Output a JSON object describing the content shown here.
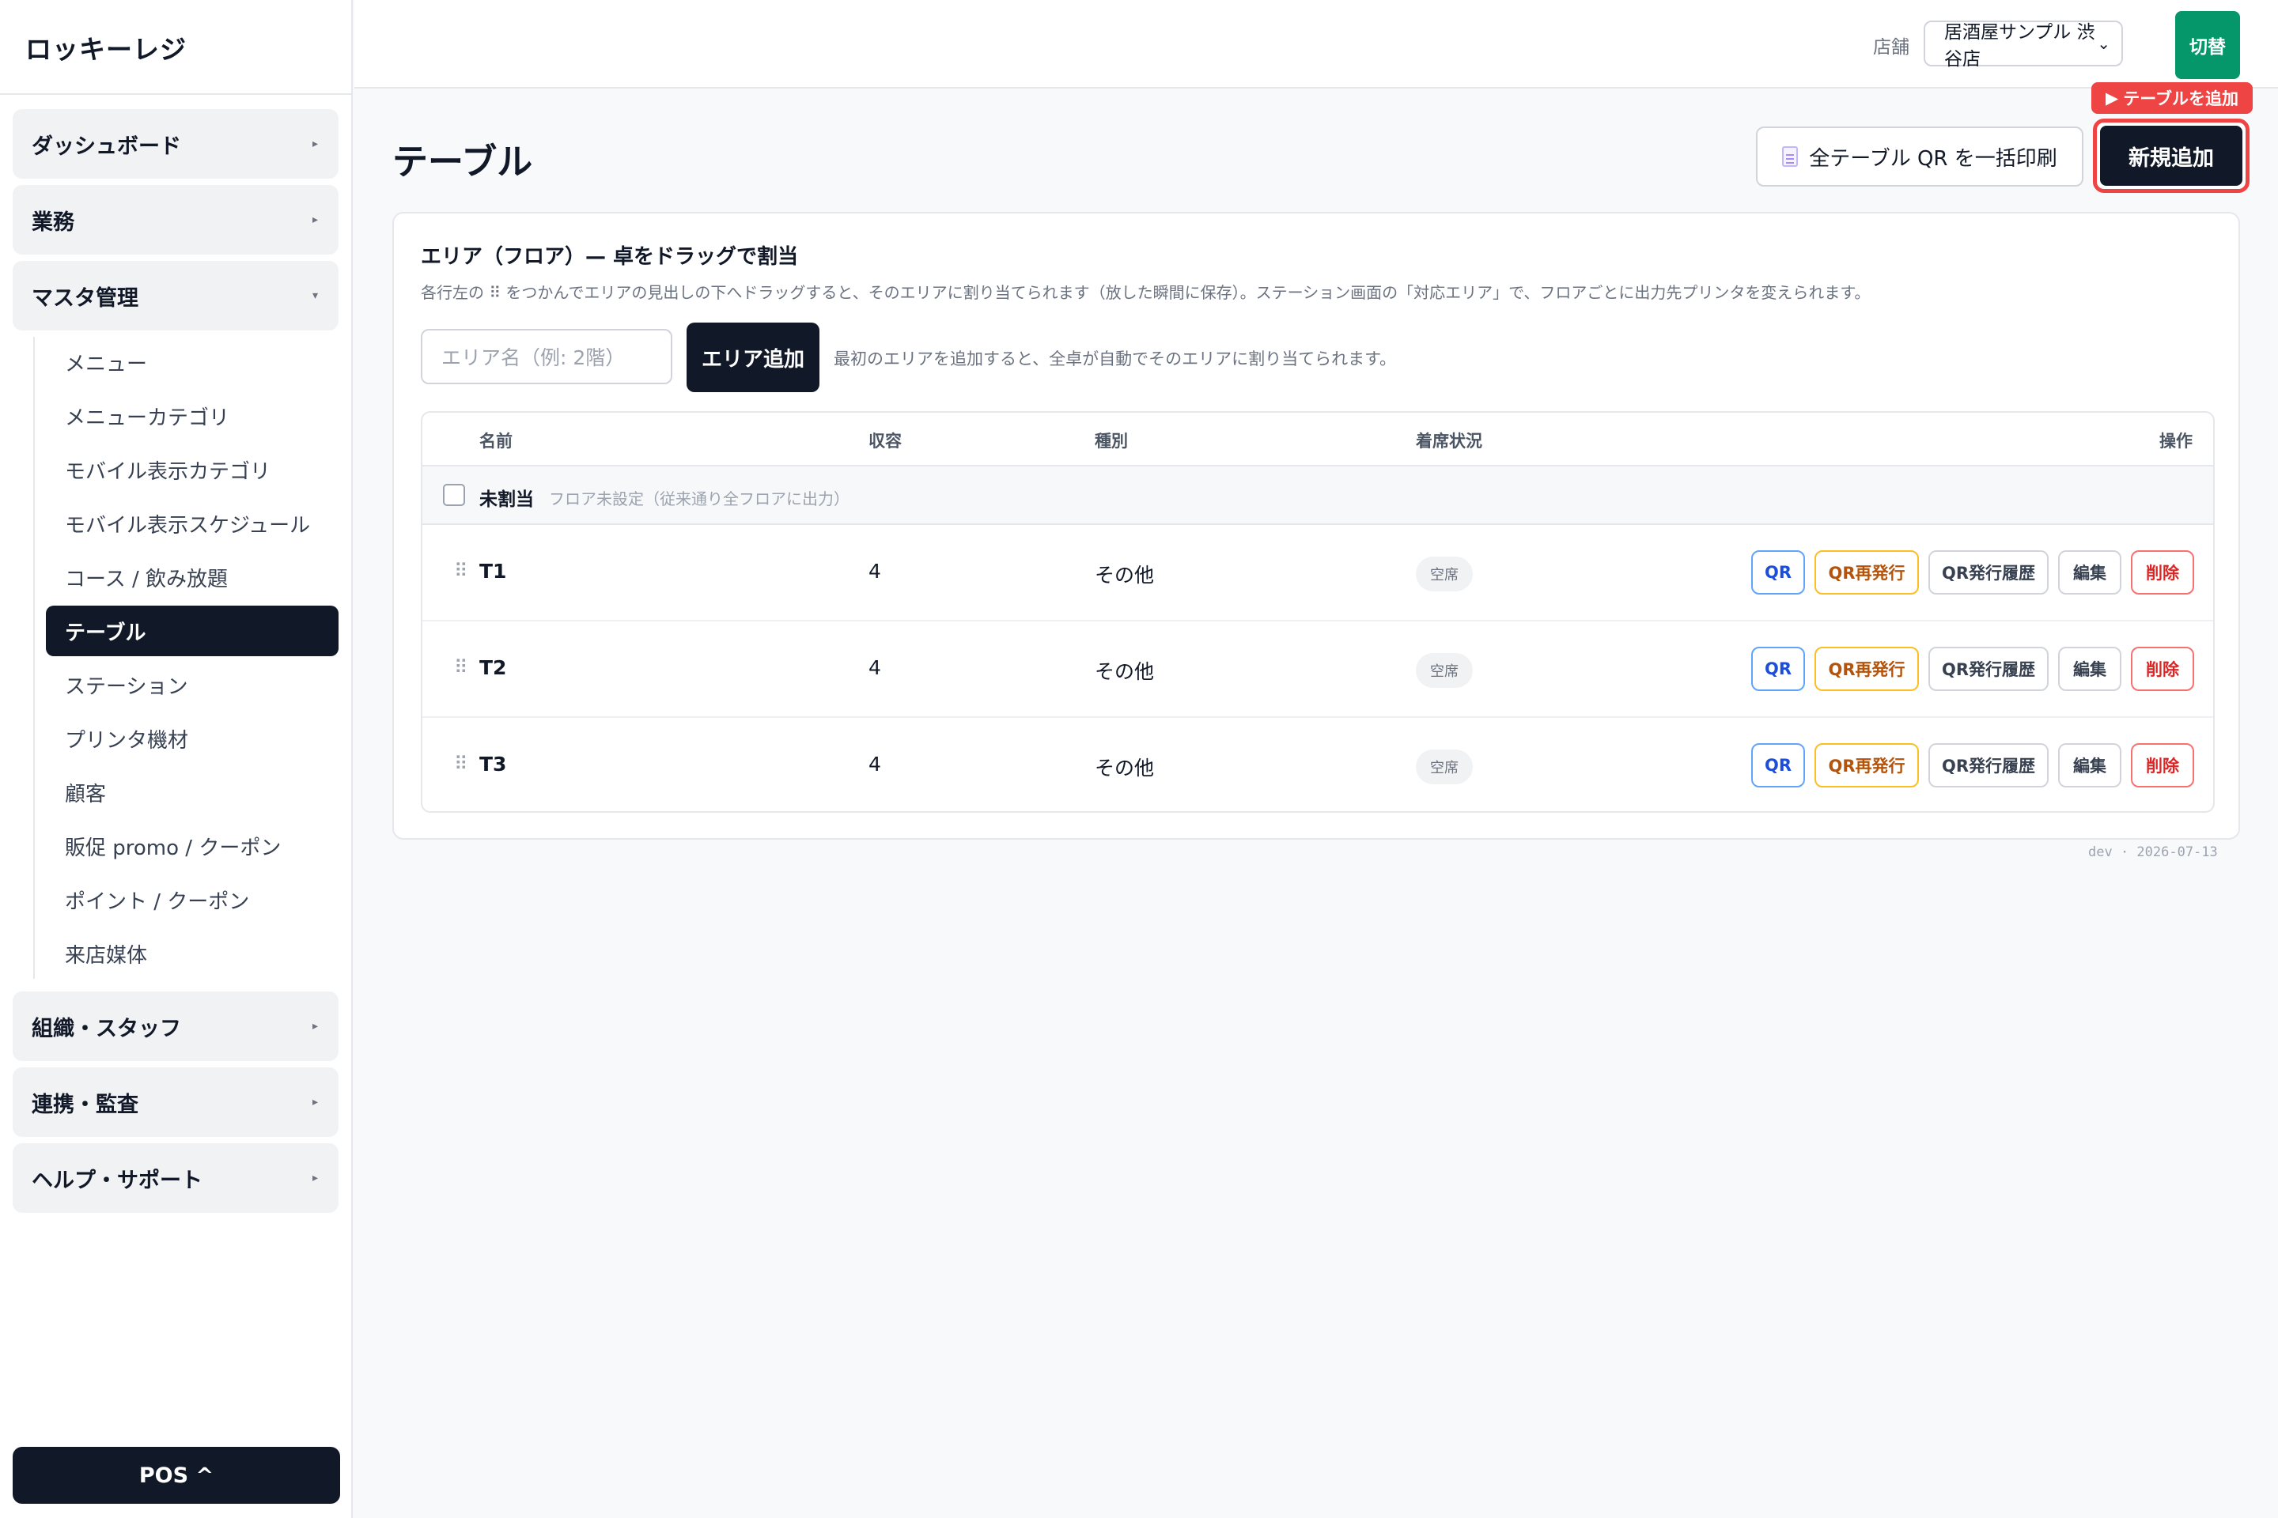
{
  "brand": "ロッキーレジ",
  "sidebar": {
    "groups_top": [
      {
        "label": "ダッシュボード",
        "caret": "▸"
      },
      {
        "label": "業務",
        "caret": "▸"
      },
      {
        "label": "マスタ管理",
        "caret": "▾"
      }
    ],
    "master_items": [
      "メニュー",
      "メニューカテゴリ",
      "モバイル表示カテゴリ",
      "モバイル表示スケジュール",
      "コース / 飲み放題",
      "テーブル",
      "ステーション",
      "プリンタ機材",
      "顧客",
      "販促 promo / クーポン",
      "ポイント / クーポン",
      "来店媒体"
    ],
    "active_item": "テーブル",
    "groups_bottom": [
      {
        "label": "組織・スタッフ",
        "caret": "▸"
      },
      {
        "label": "連携・監査",
        "caret": "▸"
      },
      {
        "label": "ヘルプ・サポート",
        "caret": "▸"
      }
    ],
    "pos_button": "POS ^"
  },
  "topbar": {
    "store_label": "店舗",
    "store_value": "居酒屋サンプル 渋谷店",
    "switch_label": "切替"
  },
  "page": {
    "title": "テーブル",
    "print_all_label": "全テーブル QR を一括印刷",
    "tip_label": "テーブルを追加",
    "new_label": "新規追加"
  },
  "area": {
    "title": "エリア（フロア）— 卓をドラッグで割当",
    "description": "各行左の ⠿ をつかんでエリアの見出しの下へドラッグすると、そのエリアに割り当てられます（放した瞬間に保存）。ステーション画面の「対応エリア」で、フロアごとに出力先プリンタを変えられます。",
    "input_placeholder": "エリア名（例: 2階）",
    "add_button": "エリア追加",
    "hint": "最初のエリアを追加すると、全卓が自動でそのエリアに割り当てられます。"
  },
  "table": {
    "headers": {
      "name": "名前",
      "capacity": "収容",
      "kind": "種別",
      "status": "着席状況",
      "actions": "操作"
    },
    "unassigned_label": "未割当",
    "unassigned_note": "フロア未設定（従来通り全フロアに出力）",
    "rows": [
      {
        "name": "T1",
        "capacity": "4",
        "kind": "その他",
        "status": "空席"
      },
      {
        "name": "T2",
        "capacity": "4",
        "kind": "その他",
        "status": "空席"
      },
      {
        "name": "T3",
        "capacity": "4",
        "kind": "その他",
        "status": "空席"
      }
    ],
    "action_labels": {
      "qr": "QR",
      "reissue": "QR再発行",
      "history": "QR発行履歴",
      "edit": "編集",
      "delete": "削除"
    }
  },
  "footer": "dev · 2026-07-13"
}
